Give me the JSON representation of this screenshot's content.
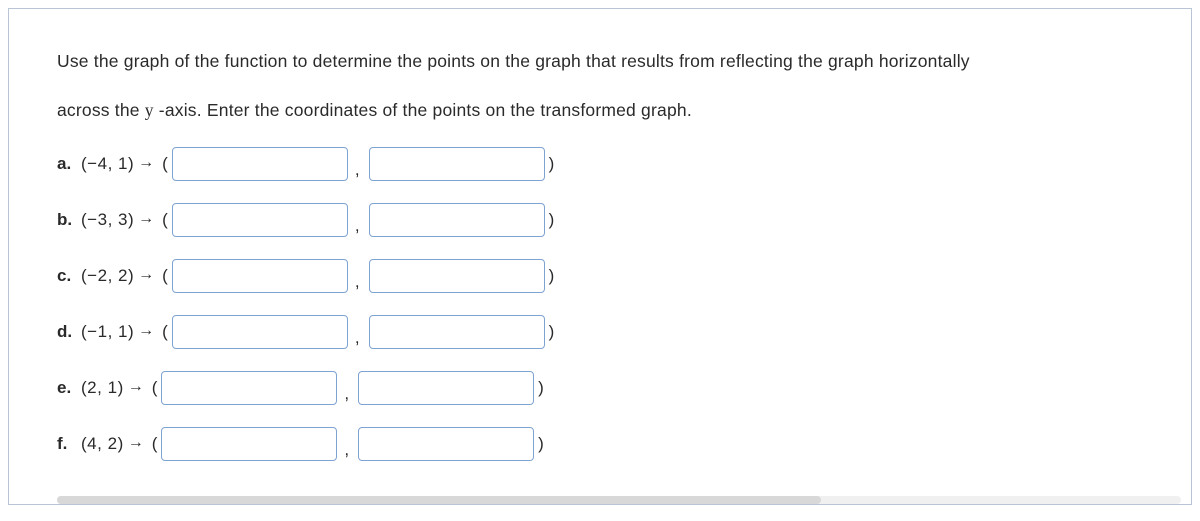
{
  "instructions": {
    "line1": "Use the graph of the function to determine the points on the graph that results from reflecting the graph horizontally",
    "line2_pre": "across the ",
    "yvar": "y",
    "line2_post": " -axis. Enter the coordinates of the points on the transformed graph."
  },
  "items": [
    {
      "label": "a.",
      "x": "−4",
      "y": "1"
    },
    {
      "label": "b.",
      "x": "−3",
      "y": "3"
    },
    {
      "label": "c.",
      "x": "−2",
      "y": "2"
    },
    {
      "label": "d.",
      "x": "−1",
      "y": "1"
    },
    {
      "label": "e.",
      "x": "2",
      "y": "1"
    },
    {
      "label": "f.",
      "x": "4",
      "y": "2"
    }
  ],
  "symbols": {
    "arrow": "→",
    "open": "(",
    "close": ")",
    "comma": ","
  }
}
